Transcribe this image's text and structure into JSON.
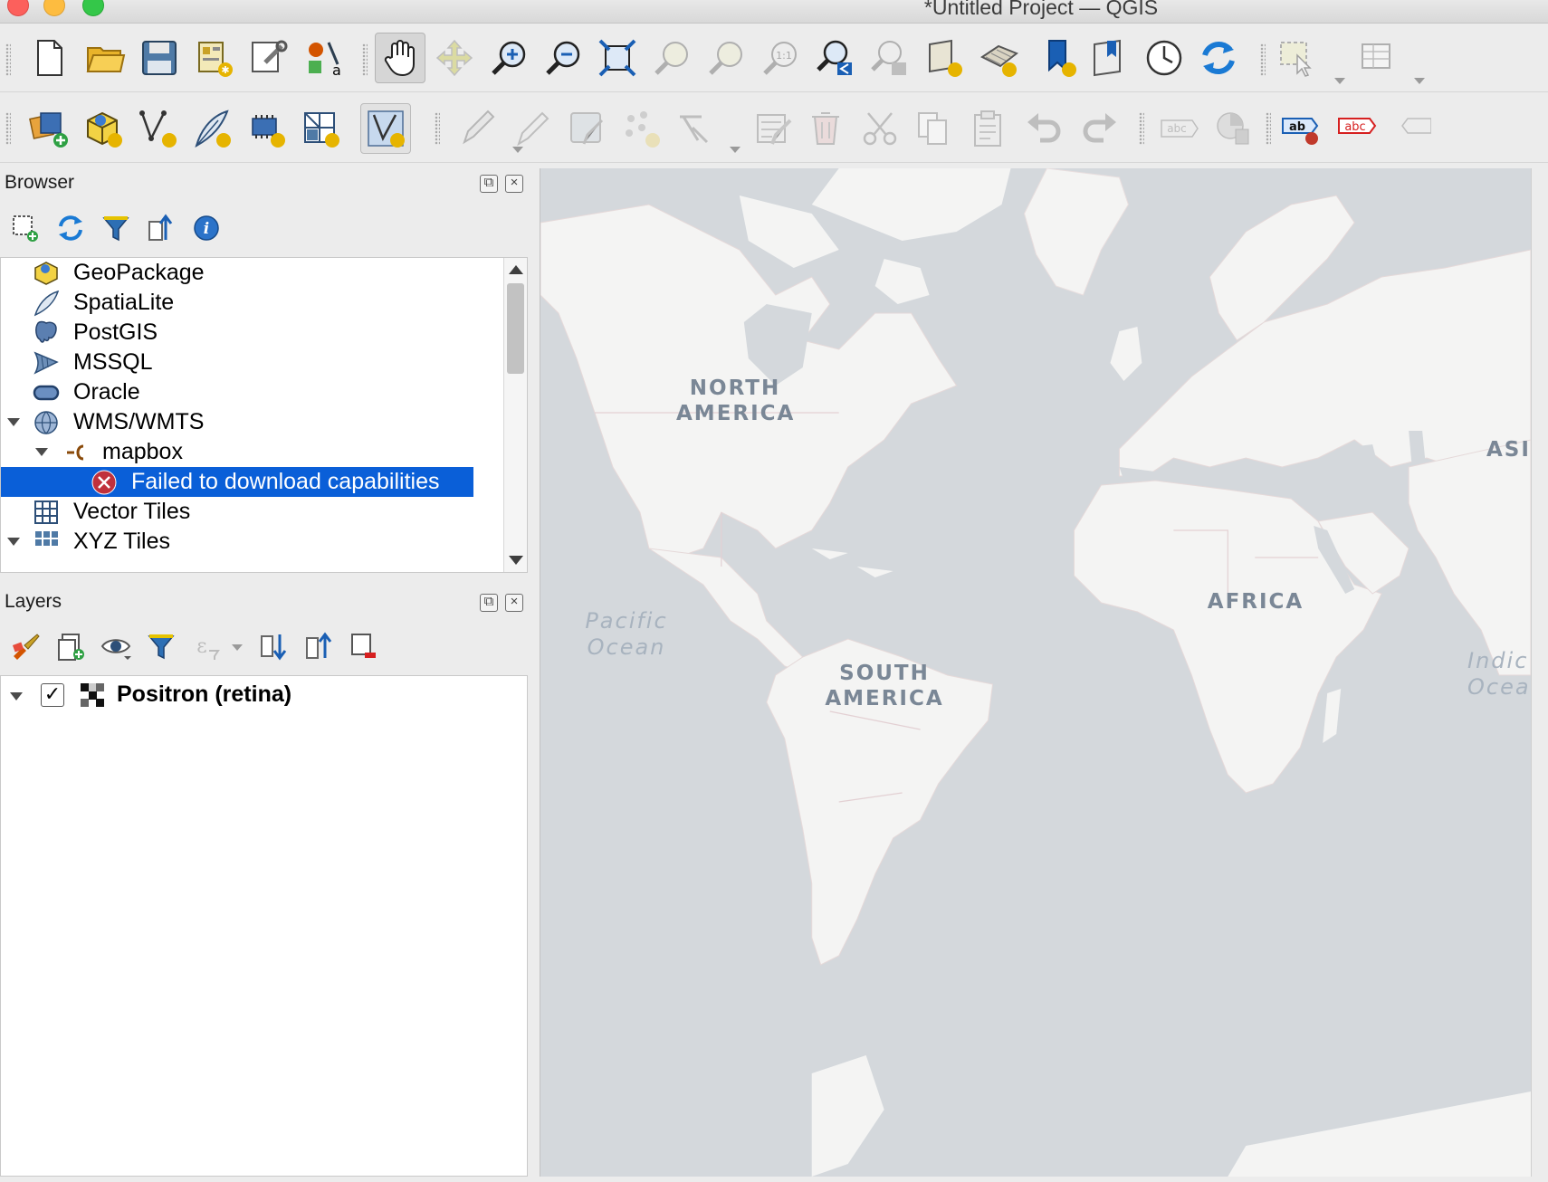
{
  "window": {
    "title": "*Untitled Project — QGIS"
  },
  "toolbar1": {
    "icons": [
      "new-project-icon",
      "open-project-icon",
      "save-project-icon",
      "print-layout-icon",
      "layout-manager-icon",
      "style-manager-icon",
      "pan-hand-icon",
      "pan-to-selection-icon",
      "zoom-in-icon",
      "zoom-out-icon",
      "zoom-full-icon",
      "zoom-to-selection-icon",
      "zoom-to-layer-icon",
      "zoom-native-icon",
      "zoom-last-icon",
      "zoom-next-icon",
      "new-map-view-icon",
      "new-3d-map-view-icon",
      "new-spatial-bookmark-icon",
      "show-bookmarks-icon",
      "temporal-controller-icon",
      "refresh-icon",
      "select-features-icon",
      "open-attribute-table-icon"
    ]
  },
  "toolbar2": {
    "icons": [
      "data-source-manager-icon",
      "new-geopackage-layer-icon",
      "new-shapefile-layer-icon",
      "new-spatialite-layer-icon",
      "new-temporary-layer-icon",
      "new-virtual-layer-icon",
      "digitize-vertex-icon",
      "current-edits-icon",
      "toggle-editing-icon",
      "save-edits-icon",
      "add-feature-icon",
      "vertex-tool-icon",
      "modify-attributes-icon",
      "delete-selected-icon",
      "cut-features-icon",
      "copy-features-icon",
      "paste-features-icon",
      "undo-icon",
      "redo-icon",
      "layer-labeling-icon",
      "diagram-icon",
      "highlight-pinned-labels-icon",
      "pin-labels-icon",
      "show-hide-labels-icon"
    ]
  },
  "browser": {
    "title": "Browser",
    "tools": [
      "add-selected-layers-icon",
      "refresh-icon",
      "filter-icon",
      "collapse-all-icon",
      "info-icon"
    ],
    "items": [
      {
        "label": "GeoPackage",
        "icon": "geopackage-icon"
      },
      {
        "label": "SpatiaLite",
        "icon": "spatialite-icon"
      },
      {
        "label": "PostGIS",
        "icon": "postgis-icon"
      },
      {
        "label": "MSSQL",
        "icon": "mssql-icon"
      },
      {
        "label": "Oracle",
        "icon": "oracle-icon"
      },
      {
        "label": "WMS/WMTS",
        "icon": "wms-icon",
        "expanded": true
      },
      {
        "label": "mapbox",
        "icon": "connection-icon",
        "expanded": true
      },
      {
        "label": "Failed to download capabilities",
        "icon": "error-icon",
        "selected": true
      },
      {
        "label": "Vector Tiles",
        "icon": "vector-tiles-icon"
      },
      {
        "label": "XYZ Tiles",
        "icon": "xyz-tiles-icon",
        "expanded": true
      }
    ]
  },
  "layers": {
    "title": "Layers",
    "tools": [
      "open-layer-styling-icon",
      "add-group-icon",
      "manage-visibility-icon",
      "filter-legend-icon",
      "filter-by-expression-icon",
      "expand-all-icon",
      "collapse-all-icon",
      "remove-layer-icon"
    ],
    "items": [
      {
        "label": "Positron (retina)",
        "checked": true,
        "icon": "raster-layer-icon"
      }
    ],
    "checkmark": "✓"
  },
  "map": {
    "background": "#d4d8dc",
    "land": "#f4f4f3",
    "labels": {
      "north_america": "NORTH\nAMERICA",
      "south_america": "SOUTH\nAMERICA",
      "africa": "AFRICA",
      "asia": "ASIA",
      "pacific": "Pacific\nOcean",
      "indian": "Indic\nOcea"
    }
  }
}
